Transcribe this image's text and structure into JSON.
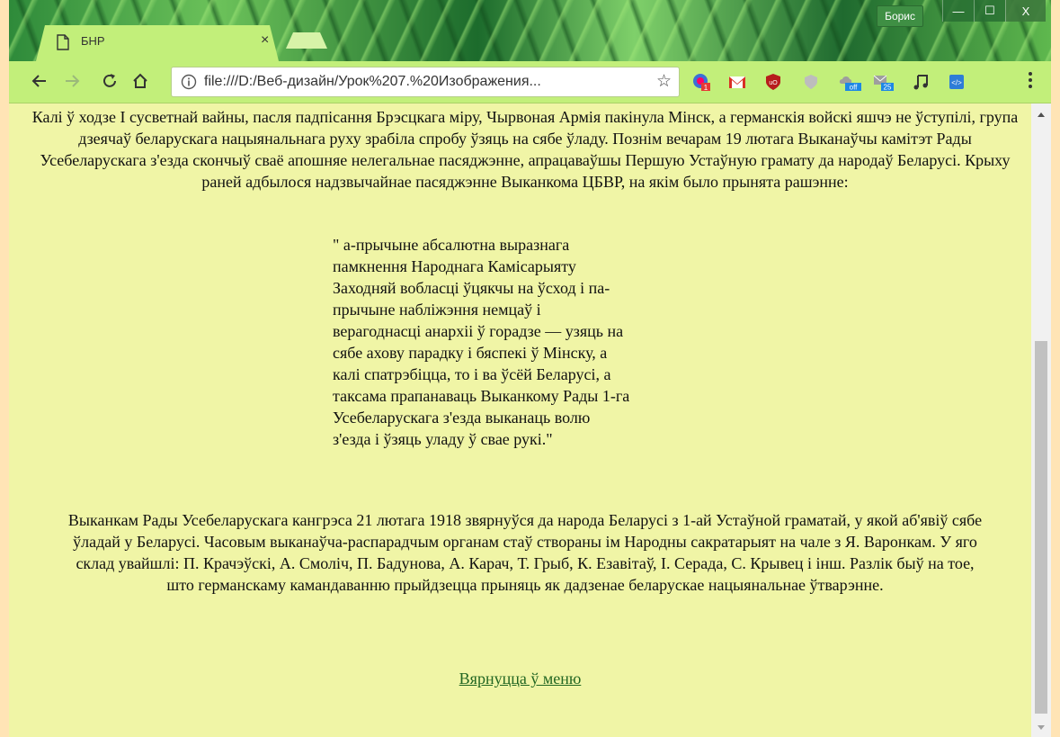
{
  "window": {
    "user": "Борис",
    "controls": {
      "minimize": "—",
      "maximize": "☐",
      "close": "X"
    }
  },
  "tab": {
    "title": "БНР",
    "close": "×"
  },
  "toolbar": {
    "url": "file:///D:/Веб-дизайн/Урок%207.%20Изображения...",
    "extensions": [
      {
        "icon": "screencastify-icon",
        "badge": "1"
      },
      {
        "icon": "gmail-icon"
      },
      {
        "icon": "ublock-icon"
      },
      {
        "icon": "shield-icon"
      },
      {
        "icon": "cloud-off-icon",
        "badge": "off"
      },
      {
        "icon": "mail-badge-icon",
        "badge": "25"
      },
      {
        "icon": "music-note-icon"
      },
      {
        "icon": "code-extension-icon"
      }
    ]
  },
  "content": {
    "paragraph1": "Калі ў ходзе І сусветнай вайны, пасля падпісання Брэсцкага міру, Чырвоная Армія пакінула Мінск, а германскія войскі яшчэ не ўступілі, група дзеячаў беларускага нацыянальнага руху зрабіла спробу ўзяць на сябе ўладу. Познім вечарам 19 лютага Выканаўчы камітэт Рады Усебеларускага з'езда скончыў сваё апошняе нелегальнае пасяджэнне, апрацаваўшы Першую Устаўную грамату да народаў Беларусі. Крыху раней адбылося надзвычайнае пасяджэнне Выканкома ЦБВР, на якім было прынята рашэнне:",
    "quote_lines": [
      "\" а-прычыне абсалютна выразнага",
      "памкнення Народнага Камісарыяту",
      "Заходняй вобласці ўцякчы на ўсход і па-",
      "прычыне набліжэння немцаў і",
      "верагоднасці анархіі ў горадзе — узяць на",
      "сябе ахову парадку і бяспекі ў Мінску, а",
      "калі спатрэбіцца, то і ва ўсёй Беларусі, а",
      "таксама прапанаваць Выканкому Рады 1-га",
      "Усебеларускага з'езда выканаць волю",
      "з'езда і ўзяць уладу ў свае рукі.\""
    ],
    "paragraph2": "Выканкам Рады Усебеларускага кангрэса 21 лютага 1918 звярнуўся да народа Беларусі з 1-ай Устаўной граматай, у якой аб'явіў сябе ўладай у Беларусі. Часовым выканаўча-распарадчым органам стаў створаны ім Народны сакратарыят на чале з Я. Варонкам. У яго склад увайшлі: П. Крачэўскі, А. Смоліч, П. Бадунова, А. Карач, Т. Грыб, К. Езавітаў, І. Серада, С. Крывец і інш. Разлік быў на тое, што германскаму камандаванню прыйдзецца прыняць як дадзенае беларускае нацыянальнае ўтварэнне.",
    "back_link": "Вярнуцца ў меню"
  },
  "colors": {
    "page_bg": "#f0f5a6",
    "toolbar_bg": "#c2ef7a",
    "link": "#226622",
    "text": "#111111"
  }
}
